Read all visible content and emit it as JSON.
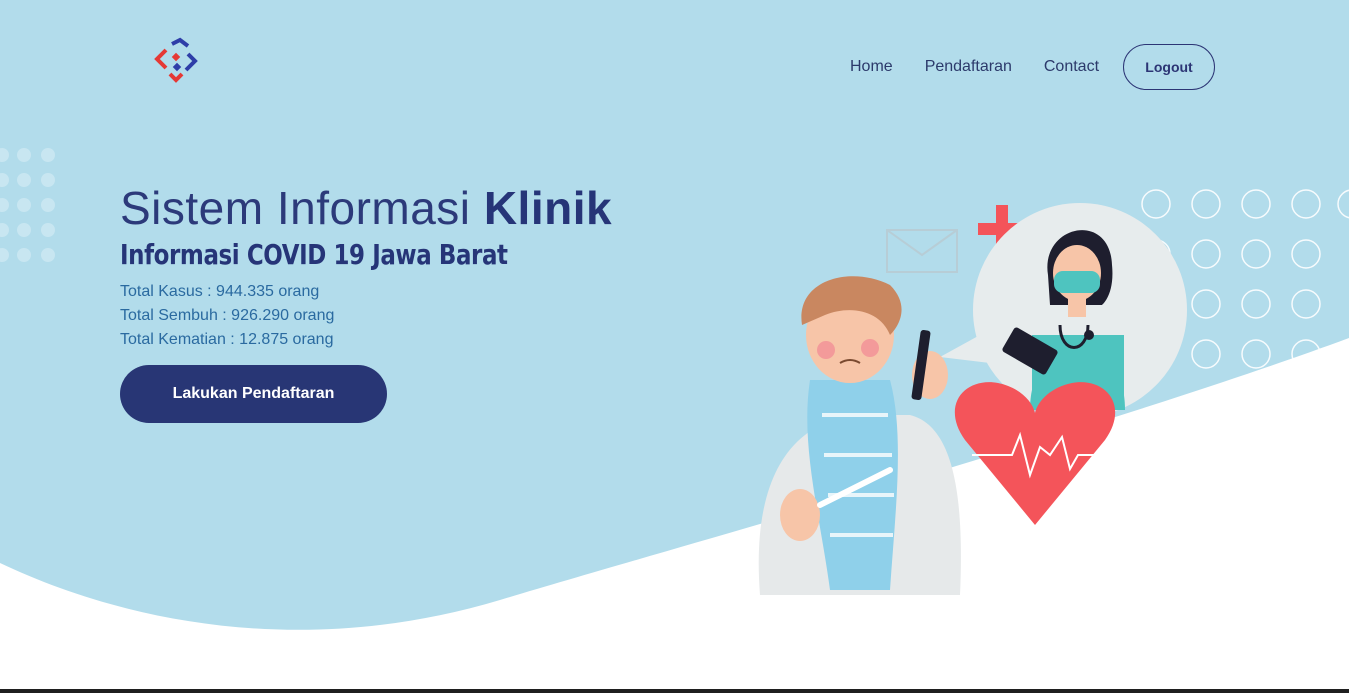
{
  "nav": {
    "home": "Home",
    "pendaftaran": "Pendaftaran",
    "contact": "Contact",
    "logout": "Logout"
  },
  "hero": {
    "title_regular": "Sistem Informasi ",
    "title_bold": "Klinik",
    "subtitle": "Informasi COVID 19 Jawa Barat",
    "stats": [
      "Total Kasus : 944.335 orang",
      "Total Sembuh : 926.290 orang",
      "Total Kematian : 12.875 orang"
    ],
    "cta_label": "Lakukan Pendaftaran"
  },
  "colors": {
    "background_blue": "#b2dceb",
    "navy": "#283675",
    "stat_text": "#2a6aa0",
    "heart_red": "#f4545a",
    "nurse_teal": "#4ec4bf"
  },
  "icons": {
    "logo": "brand-logo-icon",
    "illustration": "doctor-patient-illustration"
  }
}
